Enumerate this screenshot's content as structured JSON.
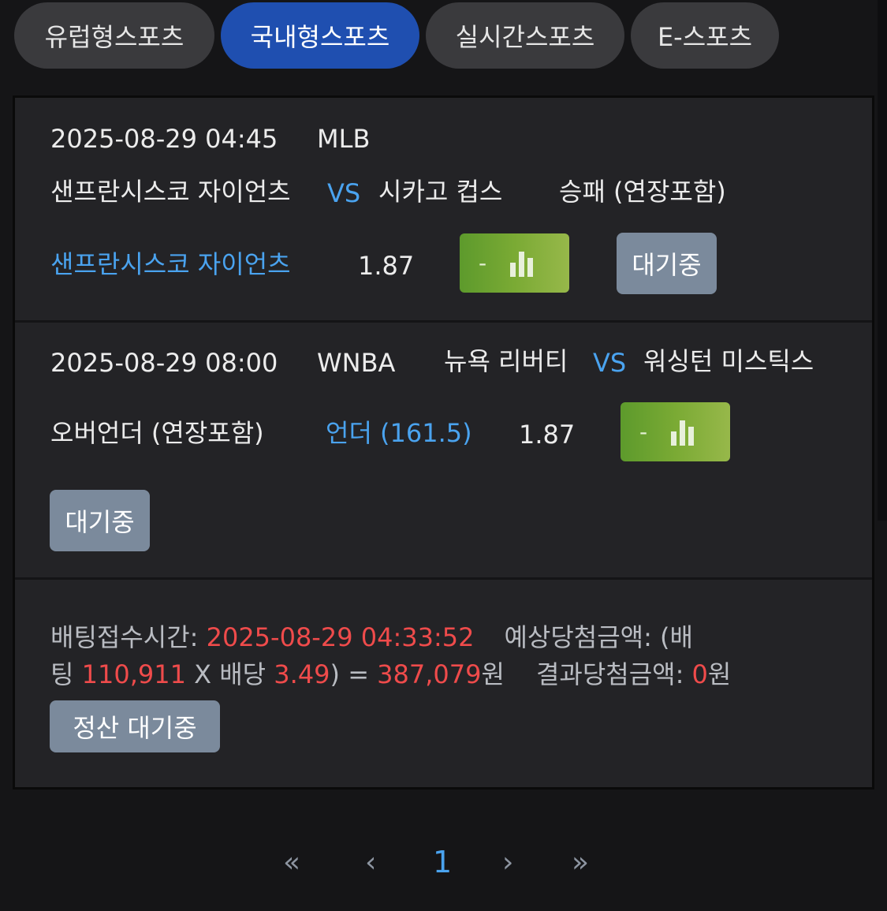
{
  "tabs": [
    {
      "label": "유럽형스포츠",
      "active": false
    },
    {
      "label": "국내형스포츠",
      "active": true
    },
    {
      "label": "실시간스포츠",
      "active": false
    },
    {
      "label": "E-스포츠",
      "active": false
    }
  ],
  "bets": [
    {
      "datetime": "2025-08-29 04:45",
      "league": "MLB",
      "home": "샌프란시스코 자이언츠",
      "vs": "VS",
      "away": "시카고 컵스",
      "market": "승패 (연장포함)",
      "pick": "샌프란시스코 자이언츠",
      "odds": "1.87",
      "result_mark": "-",
      "status": "대기중"
    },
    {
      "datetime": "2025-08-29 08:00",
      "league": "WNBA",
      "home": "뉴욕 리버티",
      "vs": "VS",
      "away": "워싱턴 미스틱스",
      "market": "오버언더 (연장포함)",
      "pick": "언더 (161.5)",
      "odds": "1.87",
      "result_mark": "-",
      "status": "대기중"
    }
  ],
  "summary": {
    "time_label": "배팅접수시간: ",
    "time_value": "2025-08-29 04:33:52",
    "expected_label_1": "예상당첨금액: (배",
    "expected_label_2": "팅 ",
    "stake": "110,911",
    "x_label": " X 배당 ",
    "total_odds": "3.49",
    "eq_label": ") = ",
    "expected_amount": "387,079",
    "won": "원",
    "result_label": "결과당첨금액: ",
    "result_amount": "0",
    "settle_button": "정산 대기중"
  },
  "pagination": {
    "first": "«",
    "prev": "‹",
    "current": "1",
    "next": "›",
    "last": "»"
  },
  "colors": {
    "accent_blue": "#4aa3ef",
    "active_tab": "#1f4fb0",
    "red": "#ef4b4b",
    "status_button": "#7b8a9c",
    "chart_button_green": "#6fa530"
  },
  "icons": {
    "chart": "bar-chart-icon"
  }
}
